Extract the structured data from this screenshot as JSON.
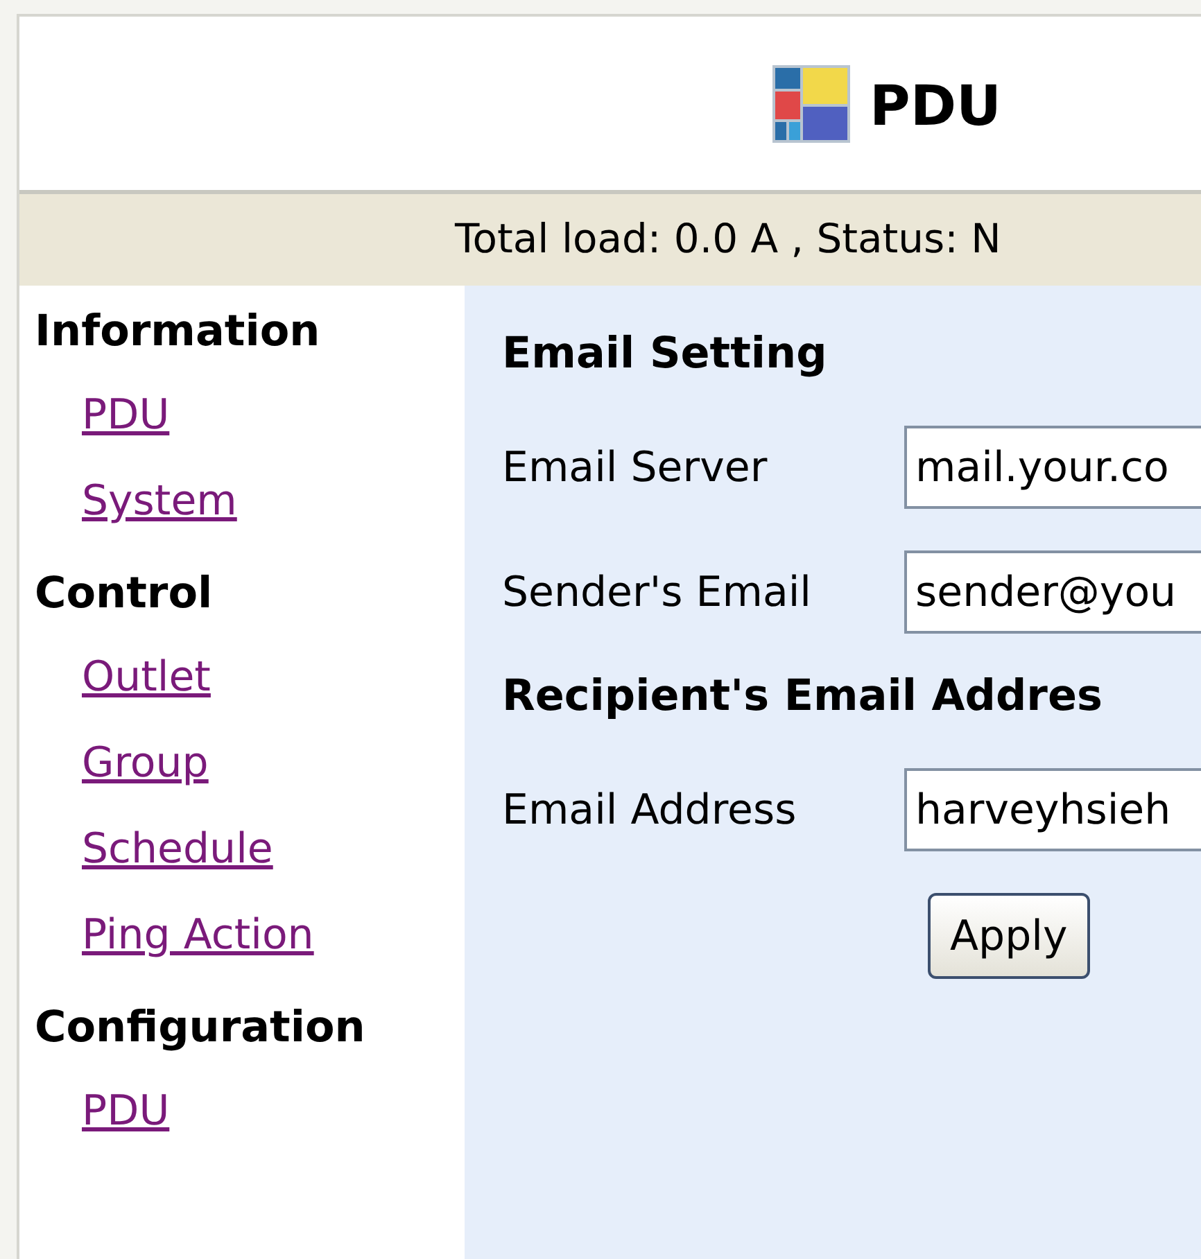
{
  "header": {
    "title": "PDU"
  },
  "status_bar": "Total load: 0.0 A , Status: N",
  "sidebar": {
    "sections": [
      {
        "heading": "Information",
        "items": [
          {
            "label": "PDU"
          },
          {
            "label": "System"
          }
        ]
      },
      {
        "heading": "Control",
        "items": [
          {
            "label": "Outlet"
          },
          {
            "label": "Group"
          },
          {
            "label": "Schedule"
          },
          {
            "label": "Ping Action"
          }
        ]
      },
      {
        "heading": "Configuration",
        "items": [
          {
            "label": "PDU"
          }
        ]
      }
    ]
  },
  "main": {
    "groups": [
      {
        "heading": "Email Setting",
        "fields": [
          {
            "label": "Email Server",
            "value": "mail.your.co"
          },
          {
            "label": "Sender's Email",
            "value": "sender@you"
          }
        ]
      },
      {
        "heading": "Recipient's Email Addres",
        "fields": [
          {
            "label": "Email Address",
            "value": "harveyhsieh"
          }
        ]
      }
    ],
    "button": "Apply"
  }
}
